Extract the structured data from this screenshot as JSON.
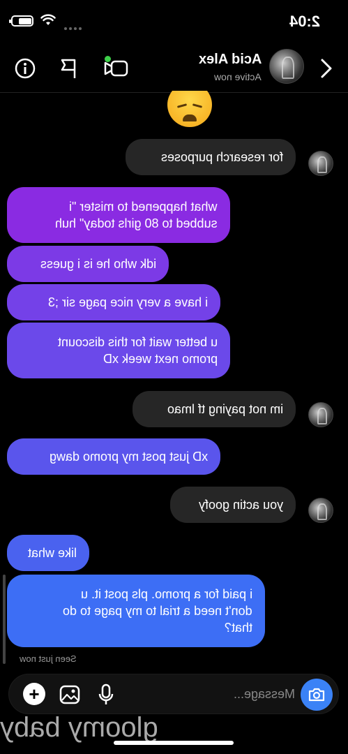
{
  "status_bar": {
    "time": "2:04"
  },
  "header": {
    "name": "Acid Alex",
    "status": "Active now",
    "icons": [
      "back-chevron-icon",
      "avatar",
      "video-call-icon",
      "flag-icon",
      "info-icon"
    ]
  },
  "messages": [
    {
      "from": "them",
      "text": "for research purposes"
    },
    {
      "from": "me",
      "text": "what happened to mister \"i subbed to 80 girls today\" huh",
      "lines": [
        "what happened to mister \"i",
        "subbed to 80 girls today\" huh"
      ]
    },
    {
      "from": "me",
      "text": "idk who he is i guess"
    },
    {
      "from": "me",
      "text": "i have a very nice page sir ;3"
    },
    {
      "from": "me",
      "text": "u better wait for this discount promo next week xD",
      "lines": [
        "u better wait for this discount",
        "promo next week xD"
      ]
    },
    {
      "from": "them",
      "text": "im not paying tf lmao"
    },
    {
      "from": "me",
      "text": "xD just post my promo dawg"
    },
    {
      "from": "them",
      "text": "you actin goofy"
    },
    {
      "from": "me",
      "text": "like what"
    },
    {
      "from": "me",
      "text": "i paid for a promo. pls post it. u don't need a trial to my page to do that?",
      "lines": [
        "i paid for a promo. pls post it. u",
        "don't need a trial to my page to do",
        "that?"
      ]
    }
  ],
  "seen_label": "Seen just now",
  "composer": {
    "placeholder": "Message..."
  },
  "watermark": "gloomy baby",
  "colors": {
    "bubble_top": "#8a2be2",
    "bubble_bottom": "#3d6ef5",
    "received": "#262626",
    "camera": "#3b82f6"
  }
}
